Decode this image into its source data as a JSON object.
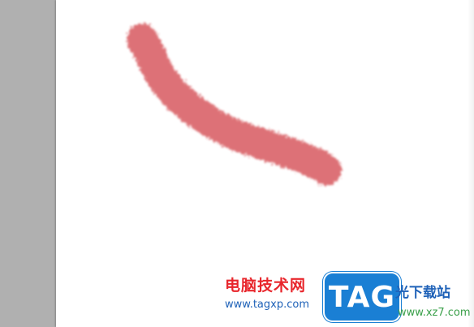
{
  "brush_stroke": {
    "color": "#dc6b70"
  },
  "watermark": {
    "chinese_text": "电脑技术网",
    "url": "www.tagxp.com",
    "badge_text": "TAG",
    "site_name": "光下载站",
    "site_url": "www.xz7.com"
  },
  "colors": {
    "gutter": "#b0b0b0",
    "canvas": "#ffffff",
    "watermark_red": "#e8262c",
    "watermark_blue": "#1f62b8",
    "badge_blue": "#1a7fd4",
    "site_green": "#3aa04a"
  }
}
